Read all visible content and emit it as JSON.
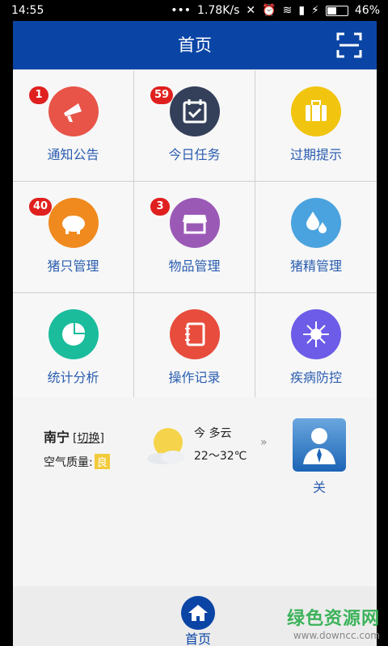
{
  "status": {
    "time": "14:55",
    "net_speed": "1.78K/s",
    "battery": "46%",
    "battery_level": 0.46
  },
  "topbar": {
    "title": "首页"
  },
  "grid": [
    {
      "label": "通知公告",
      "badge": "1",
      "color": "#e85448",
      "icon": "megaphone-icon"
    },
    {
      "label": "今日任务",
      "badge": "59",
      "color": "#34405a",
      "icon": "calendar-check-icon"
    },
    {
      "label": "过期提示",
      "badge": "",
      "color": "#f1c40f",
      "icon": "briefcase-icon"
    },
    {
      "label": "猪只管理",
      "badge": "40",
      "color": "#f08a1e",
      "icon": "piggy-bank-icon"
    },
    {
      "label": "物品管理",
      "badge": "3",
      "color": "#9b59b6",
      "icon": "shop-icon"
    },
    {
      "label": "猪精管理",
      "badge": "",
      "color": "#4aa3df",
      "icon": "drops-icon"
    },
    {
      "label": "统计分析",
      "badge": "",
      "color": "#1abc9c",
      "icon": "pie-chart-icon"
    },
    {
      "label": "操作记录",
      "badge": "",
      "color": "#e74c3c",
      "icon": "notebook-icon"
    },
    {
      "label": "疾病防控",
      "badge": "",
      "color": "#6c5ce7",
      "icon": "virus-icon"
    }
  ],
  "weather": {
    "city": "南宁",
    "switch": "[切换]",
    "air_quality_label": "空气质量:",
    "air_quality": "良",
    "today": "今 多云",
    "temp": "22～32℃",
    "more": "»"
  },
  "user": {
    "label": "关"
  },
  "bottom_nav": {
    "home_label": "首页"
  },
  "watermark": {
    "line1": "绿色资源网",
    "line2": "www.downcc.com"
  }
}
